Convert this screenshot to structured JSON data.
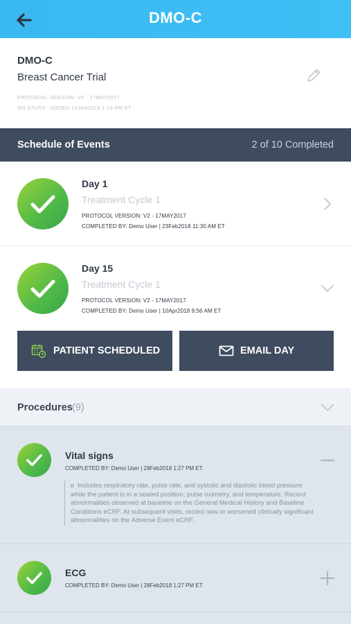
{
  "header": {
    "title": "DMO-C"
  },
  "study": {
    "code": "DMO-C",
    "name": "Breast Cancer Trial",
    "protocol": "PROTOCOL VERSION: V2 - 17MAY2017",
    "on_study": "ON STUDY : ADDED 24JAN2018 1:23 PM ET"
  },
  "schedule": {
    "label": "Schedule of Events",
    "progress": "2 of 10 Completed"
  },
  "events": [
    {
      "day": "Day 1",
      "cycle": "Treatment Cycle 1",
      "protocol": "PROTOCOL VERSION: V2 - 17MAY2017",
      "completed": "COMPLETED BY: Demo User | 23Feb2018 11:30 AM ET"
    },
    {
      "day": "Day 15",
      "cycle": "Treatment Cycle 1",
      "protocol": "PROTOCOL VERSION: V2 - 17MAY2017",
      "completed": "COMPLETED BY: Demo User | 10Apr2018 9:56 AM ET"
    }
  ],
  "buttons": {
    "patient_scheduled": "PATIENT SCHEDULED",
    "email_day": "EMAIL DAY"
  },
  "procedures": {
    "label": "Procedures",
    "count": "(9)",
    "items": [
      {
        "title": "Vital signs",
        "completed": "COMPLETED BY: Demo User | 28Feb2018 1:27 PM ET",
        "note_marker": "e",
        "note": "Includes respiratory rate, pulse rate, and systolic and diastolic blood pressure while the patient is in a seated position, pulse oximetry, and temperature. Record abnormalities observed at baseline on the General Medical History and Baseline Conditions eCRF. At subsequent visits, record new or worsened clinically significant abnormalities on the Adverse Event eCRF."
      },
      {
        "title": "ECG",
        "completed": "COMPLETED BY: Demo User | 28Feb2018 1:27 PM ET"
      }
    ]
  },
  "colors": {
    "accent": "#3ab8f0",
    "dark_bar": "#3f4b5e",
    "success": "#4fb948"
  },
  "icons": [
    "back-arrow-icon",
    "pencil-icon",
    "checkmark-icon",
    "chevron-right-icon",
    "chevron-down-icon",
    "calendar-clock-icon",
    "envelope-icon",
    "minus-icon",
    "plus-icon"
  ]
}
